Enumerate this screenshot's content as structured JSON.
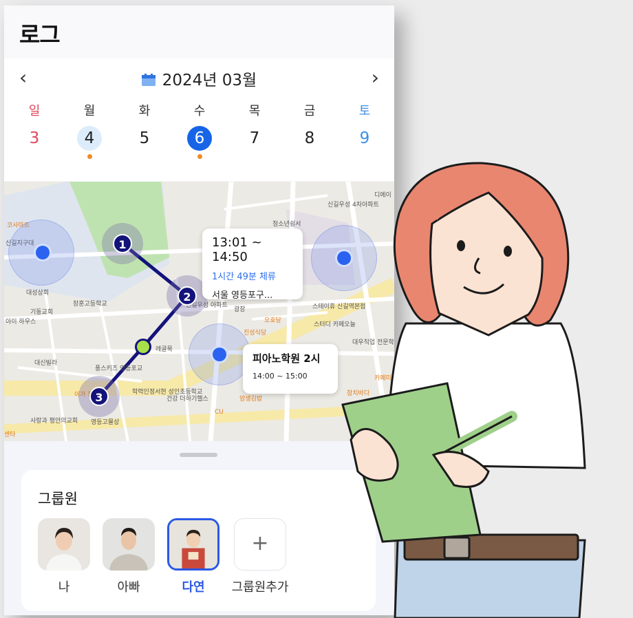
{
  "app": {
    "title": "로그"
  },
  "calendar": {
    "month_label": "2024년 03월",
    "prev_icon": "chevron-left-icon",
    "next_icon": "chevron-right-icon",
    "days": [
      {
        "dow": "일",
        "date": "3",
        "type": "sun",
        "dot": false
      },
      {
        "dow": "월",
        "date": "4",
        "type": "light",
        "dot": true
      },
      {
        "dow": "화",
        "date": "5",
        "type": "normal",
        "dot": false
      },
      {
        "dow": "수",
        "date": "6",
        "type": "selected",
        "dot": true
      },
      {
        "dow": "목",
        "date": "7",
        "type": "normal",
        "dot": false
      },
      {
        "dow": "금",
        "date": "8",
        "type": "normal",
        "dot": false
      },
      {
        "dow": "토",
        "date": "9",
        "type": "sat",
        "dot": false
      }
    ]
  },
  "map": {
    "stops": [
      "1",
      "2",
      "3"
    ],
    "bubble_main": {
      "time": "13:01 ~ 14:50",
      "duration": "1시간 49분 체류",
      "place": "서울 영등포구..."
    },
    "bubble_event": {
      "title": "피아노학원 2시",
      "time": "14:00 ~ 15:00"
    },
    "labels": {
      "l1": "코사마트",
      "l2": "신길지구대",
      "l3": "대성상회",
      "l4": "기동교회",
      "l5": "장훈고등학교",
      "l6": "아이 하우스",
      "l7": "대신빌라",
      "l8": "풍스키즈 영등포교",
      "l9": "학력인정서현 성인초등학교",
      "l10": "이가 참숯",
      "l11": "사랑과 평안의교회",
      "l12": "영등고물상",
      "l13": "센타",
      "l14": "신길우성 4차아파트",
      "l15": "청소년쉼서",
      "l16": "디에이",
      "l17": "스테이휴 신길역본점",
      "l18": "스터디 카페오늘",
      "l19": "오호당",
      "l20": "진성식당",
      "l21": "대우직업 전문학교",
      "l22": "카페미",
      "l23": "참치바다",
      "l24": "암생김밥",
      "l25": "건강 더하기헬스",
      "l26": "CU",
      "l27": "신길우성 아파트",
      "l28": "레골목",
      "l29": "광장"
    }
  },
  "group": {
    "title": "그룹원",
    "members": [
      {
        "name": "나"
      },
      {
        "name": "아빠"
      },
      {
        "name": "다연",
        "selected": true
      }
    ],
    "add_label": "그룹원추가",
    "add_icon": "plus-icon"
  },
  "colors": {
    "primary": "#1764e6",
    "route": "#13137a",
    "sunday": "#e0465b",
    "saturday": "#3b8fe6",
    "event_dot": "#f08a24",
    "duration_text": "#2a6ef0",
    "waypoint": "#a8e04a"
  }
}
